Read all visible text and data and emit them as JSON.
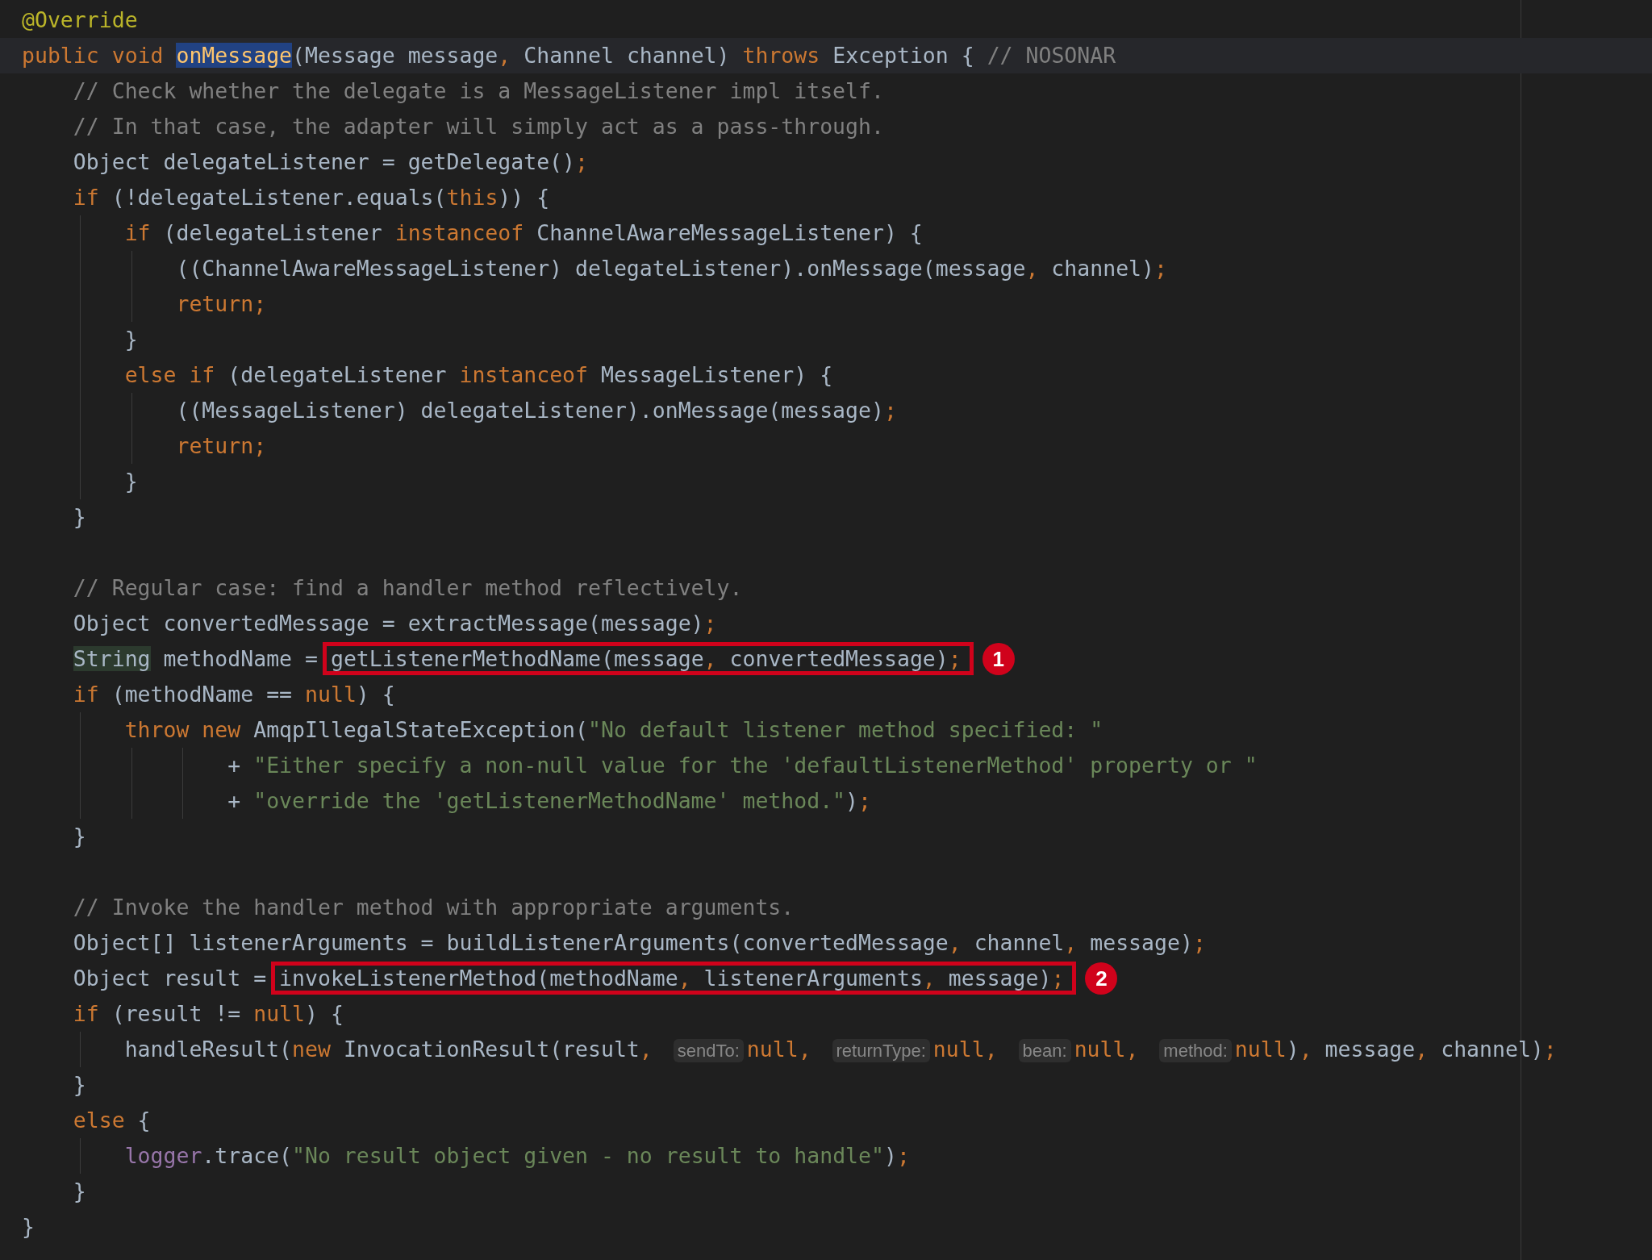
{
  "editor": {
    "lines": [
      {
        "kind": "code",
        "current": false,
        "tokens": [
          {
            "kind": "ann",
            "t": "@Override"
          }
        ]
      },
      {
        "kind": "code",
        "current": true,
        "tokens": [
          {
            "kind": "kw",
            "t": "public void "
          },
          {
            "kind": "decl",
            "t": "onMessage"
          },
          {
            "kind": "p",
            "t": "(Message message"
          },
          {
            "kind": "kw",
            "t": ", "
          },
          {
            "kind": "p",
            "t": "Channel channel) "
          },
          {
            "kind": "kw",
            "t": "throws "
          },
          {
            "kind": "p",
            "t": "Exception { "
          },
          {
            "kind": "cm",
            "t": "// NOSONAR"
          }
        ],
        "children": [
          {
            "kind": "code",
            "current": false,
            "tokens": [
              {
                "kind": "cm",
                "t": "// Check whether the delegate is a MessageListener impl itself."
              }
            ]
          },
          {
            "kind": "code",
            "current": false,
            "tokens": [
              {
                "kind": "cm",
                "t": "// In that case, the adapter will simply act as a pass-through."
              }
            ]
          },
          {
            "kind": "code",
            "current": false,
            "tokens": [
              {
                "kind": "p",
                "t": "Object delegateListener = getDelegate()"
              },
              {
                "kind": "kw",
                "t": ";"
              }
            ]
          },
          {
            "kind": "code",
            "current": false,
            "tokens": [
              {
                "kind": "kw",
                "t": "if "
              },
              {
                "kind": "p",
                "t": "(!delegateListener.equals("
              },
              {
                "kind": "kw",
                "t": "this"
              },
              {
                "kind": "p",
                "t": ")) {"
              }
            ],
            "children": [
              {
                "kind": "code",
                "current": false,
                "tokens": [
                  {
                    "kind": "kw",
                    "t": "if "
                  },
                  {
                    "kind": "p",
                    "t": "(delegateListener "
                  },
                  {
                    "kind": "kw",
                    "t": "instanceof "
                  },
                  {
                    "kind": "p",
                    "t": "ChannelAwareMessageListener) {"
                  }
                ],
                "children": [
                  {
                    "kind": "code",
                    "current": false,
                    "tokens": [
                      {
                        "kind": "p",
                        "t": "((ChannelAwareMessageListener) delegateListener).onMessage(message"
                      },
                      {
                        "kind": "kw",
                        "t": ", "
                      },
                      {
                        "kind": "p",
                        "t": "channel)"
                      },
                      {
                        "kind": "kw",
                        "t": ";"
                      }
                    ]
                  },
                  {
                    "kind": "code",
                    "current": false,
                    "tokens": [
                      {
                        "kind": "kw",
                        "t": "return;"
                      }
                    ]
                  }
                ]
              },
              {
                "kind": "code",
                "current": false,
                "tokens": [
                  {
                    "kind": "p",
                    "t": "}"
                  }
                ]
              },
              {
                "kind": "code",
                "current": false,
                "tokens": [
                  {
                    "kind": "kw",
                    "t": "else if "
                  },
                  {
                    "kind": "p",
                    "t": "(delegateListener "
                  },
                  {
                    "kind": "kw",
                    "t": "instanceof "
                  },
                  {
                    "kind": "p",
                    "t": "MessageListener) {"
                  }
                ],
                "children": [
                  {
                    "kind": "code",
                    "current": false,
                    "tokens": [
                      {
                        "kind": "p",
                        "t": "((MessageListener) delegateListener).onMessage(message)"
                      },
                      {
                        "kind": "kw",
                        "t": ";"
                      }
                    ]
                  },
                  {
                    "kind": "code",
                    "current": false,
                    "tokens": [
                      {
                        "kind": "kw",
                        "t": "return;"
                      }
                    ]
                  }
                ]
              },
              {
                "kind": "code",
                "current": false,
                "tokens": [
                  {
                    "kind": "p",
                    "t": "}"
                  }
                ]
              }
            ]
          },
          {
            "kind": "code",
            "current": false,
            "tokens": [
              {
                "kind": "p",
                "t": "}"
              }
            ]
          },
          {
            "kind": "blank"
          },
          {
            "kind": "code",
            "current": false,
            "tokens": [
              {
                "kind": "cm",
                "t": "// Regular case: find a handler method reflectively."
              }
            ]
          },
          {
            "kind": "code",
            "current": false,
            "tokens": [
              {
                "kind": "p",
                "t": "Object convertedMessage = extractMessage(message)"
              },
              {
                "kind": "kw",
                "t": ";"
              }
            ]
          },
          {
            "kind": "code",
            "current": false,
            "tokens": [
              {
                "kind": "type",
                "t": "String"
              },
              {
                "kind": "p",
                "t": " methodName = "
              },
              {
                "kind": "box",
                "badge": "1",
                "tokens": [
                  {
                    "kind": "p",
                    "t": "getListenerMethodName(message"
                  },
                  {
                    "kind": "kw",
                    "t": ", "
                  },
                  {
                    "kind": "p",
                    "t": "convertedMessage)"
                  },
                  {
                    "kind": "kw",
                    "t": ";"
                  }
                ]
              }
            ]
          },
          {
            "kind": "code",
            "current": false,
            "tokens": [
              {
                "kind": "kw",
                "t": "if "
              },
              {
                "kind": "p",
                "t": "(methodName == "
              },
              {
                "kind": "kw",
                "t": "null"
              },
              {
                "kind": "p",
                "t": ") {"
              }
            ],
            "children": [
              {
                "kind": "code",
                "current": false,
                "tokens": [
                  {
                    "kind": "kw",
                    "t": "throw new "
                  },
                  {
                    "kind": "p",
                    "t": "AmqpIllegalStateException("
                  },
                  {
                    "kind": "str",
                    "t": "\"No default listener method specified: \""
                  }
                ],
                "children": [
                  {
                    "kind": "continuation",
                    "current": false,
                    "tokens": [
                      {
                        "kind": "p",
                        "t": "+ "
                      },
                      {
                        "kind": "str",
                        "t": "\"Either specify a non-null value for the 'defaultListenerMethod' property or \""
                      }
                    ]
                  },
                  {
                    "kind": "continuation",
                    "current": false,
                    "tokens": [
                      {
                        "kind": "p",
                        "t": "+ "
                      },
                      {
                        "kind": "str",
                        "t": "\"override the 'getListenerMethodName' method.\""
                      },
                      {
                        "kind": "p",
                        "t": ")"
                      },
                      {
                        "kind": "kw",
                        "t": ";"
                      }
                    ]
                  }
                ]
              }
            ]
          },
          {
            "kind": "code",
            "current": false,
            "tokens": [
              {
                "kind": "p",
                "t": "}"
              }
            ]
          },
          {
            "kind": "blank"
          },
          {
            "kind": "code",
            "current": false,
            "tokens": [
              {
                "kind": "cm",
                "t": "// Invoke the handler method with appropriate arguments."
              }
            ]
          },
          {
            "kind": "code",
            "current": false,
            "tokens": [
              {
                "kind": "p",
                "t": "Object[] listenerArguments = buildListenerArguments(convertedMessage"
              },
              {
                "kind": "kw",
                "t": ", "
              },
              {
                "kind": "p",
                "t": "channel"
              },
              {
                "kind": "kw",
                "t": ", "
              },
              {
                "kind": "p",
                "t": "message)"
              },
              {
                "kind": "kw",
                "t": ";"
              }
            ]
          },
          {
            "kind": "code",
            "current": false,
            "tokens": [
              {
                "kind": "p",
                "t": "Object result = "
              },
              {
                "kind": "box",
                "badge": "2",
                "tokens": [
                  {
                    "kind": "p",
                    "t": "invokeListenerMethod(methodName"
                  },
                  {
                    "kind": "kw",
                    "t": ", "
                  },
                  {
                    "kind": "p",
                    "t": "listenerArguments"
                  },
                  {
                    "kind": "kw",
                    "t": ", "
                  },
                  {
                    "kind": "p",
                    "t": "message)"
                  },
                  {
                    "kind": "kw",
                    "t": ";"
                  }
                ]
              }
            ]
          },
          {
            "kind": "code",
            "current": false,
            "tokens": [
              {
                "kind": "kw",
                "t": "if "
              },
              {
                "kind": "p",
                "t": "(result != "
              },
              {
                "kind": "kw",
                "t": "null"
              },
              {
                "kind": "p",
                "t": ") {"
              }
            ],
            "children": [
              {
                "kind": "code",
                "current": false,
                "tokens": [
                  {
                    "kind": "p",
                    "t": "handleResult("
                  },
                  {
                    "kind": "kw",
                    "t": "new "
                  },
                  {
                    "kind": "p",
                    "t": "InvocationResult(result"
                  },
                  {
                    "kind": "kw",
                    "t": ", "
                  },
                  {
                    "kind": "hint",
                    "t": "sendTo:"
                  },
                  {
                    "kind": "kw",
                    "t": "null, "
                  },
                  {
                    "kind": "hint",
                    "t": "returnType:"
                  },
                  {
                    "kind": "kw",
                    "t": "null, "
                  },
                  {
                    "kind": "hint",
                    "t": "bean:"
                  },
                  {
                    "kind": "kw",
                    "t": "null, "
                  },
                  {
                    "kind": "hint",
                    "t": "method:"
                  },
                  {
                    "kind": "kw",
                    "t": "null"
                  },
                  {
                    "kind": "p",
                    "t": ")"
                  },
                  {
                    "kind": "kw",
                    "t": ", "
                  },
                  {
                    "kind": "p",
                    "t": "message"
                  },
                  {
                    "kind": "kw",
                    "t": ", "
                  },
                  {
                    "kind": "p",
                    "t": "channel)"
                  },
                  {
                    "kind": "kw",
                    "t": ";"
                  }
                ]
              }
            ]
          },
          {
            "kind": "code",
            "current": false,
            "tokens": [
              {
                "kind": "p",
                "t": "}"
              }
            ]
          },
          {
            "kind": "code",
            "current": false,
            "tokens": [
              {
                "kind": "kw",
                "t": "else "
              },
              {
                "kind": "p",
                "t": "{"
              }
            ],
            "children": [
              {
                "kind": "code",
                "current": false,
                "tokens": [
                  {
                    "kind": "field",
                    "t": "logger"
                  },
                  {
                    "kind": "p",
                    "t": ".trace("
                  },
                  {
                    "kind": "str",
                    "t": "\"No result object given - no result to handle\""
                  },
                  {
                    "kind": "p",
                    "t": ")"
                  },
                  {
                    "kind": "kw",
                    "t": ";"
                  }
                ]
              }
            ]
          },
          {
            "kind": "code",
            "current": false,
            "tokens": [
              {
                "kind": "p",
                "t": "}"
              }
            ]
          }
        ]
      },
      {
        "kind": "code",
        "current": false,
        "tokens": [
          {
            "kind": "p",
            "t": "}"
          }
        ]
      }
    ]
  }
}
